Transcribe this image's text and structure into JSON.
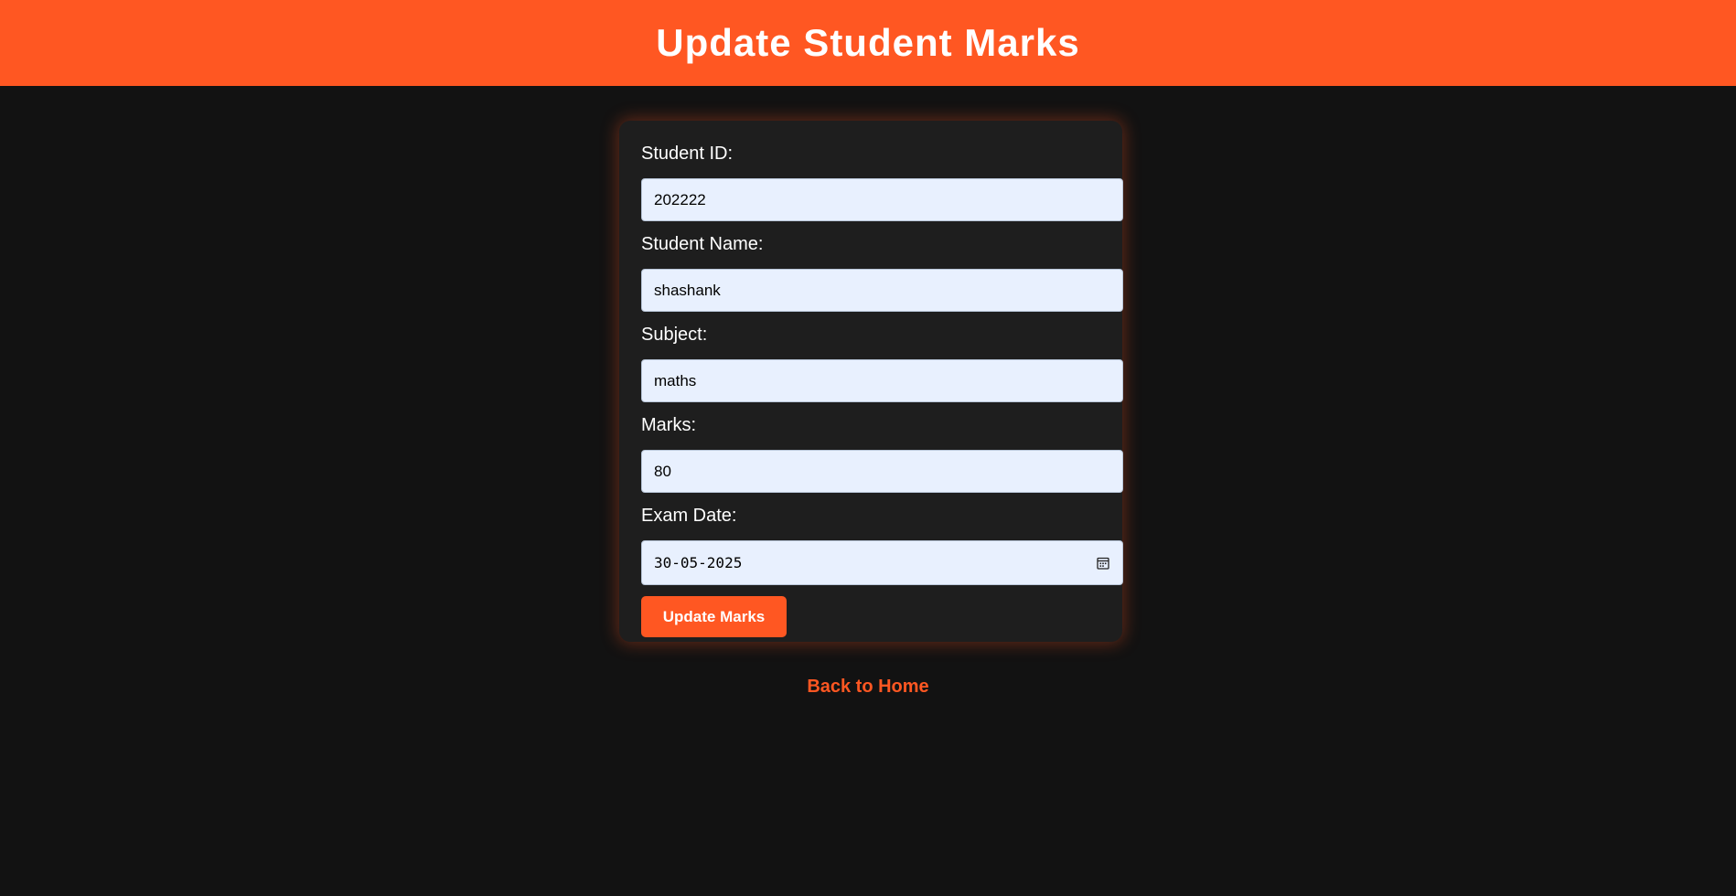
{
  "header": {
    "title": "Update Student Marks"
  },
  "form": {
    "student_id": {
      "label": "Student ID:",
      "value": "202222"
    },
    "student_name": {
      "label": "Student Name:",
      "value": "shashank"
    },
    "subject": {
      "label": "Subject:",
      "value": "maths"
    },
    "marks": {
      "label": "Marks:",
      "value": "80"
    },
    "exam_date": {
      "label": "Exam Date:",
      "value": "30-05-2025",
      "icon": "calendar-icon"
    },
    "submit_label": "Update Marks"
  },
  "footer": {
    "back_link": "Back to Home"
  },
  "colors": {
    "accent": "#ff5722",
    "background": "#121212",
    "card": "#1e1e1e",
    "input": "#e8f0fe"
  }
}
